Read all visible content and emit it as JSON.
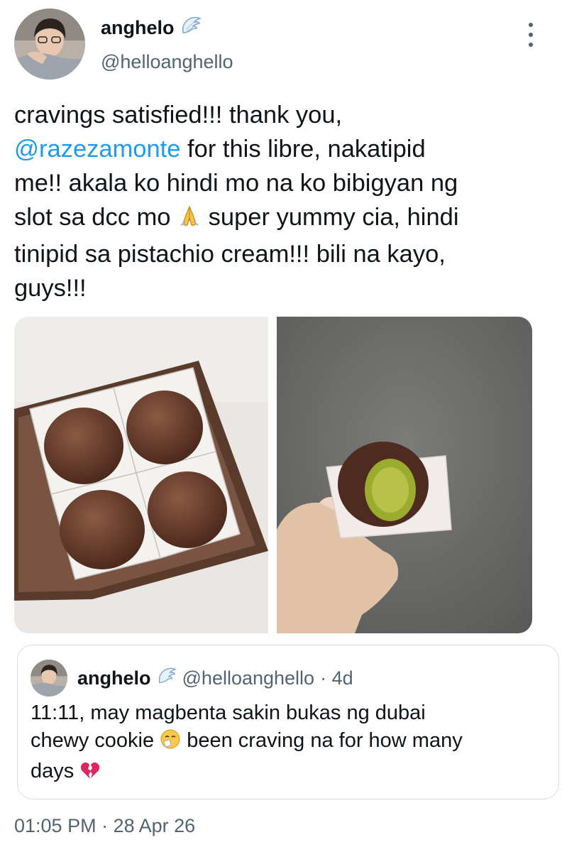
{
  "author": {
    "name": "anghelo",
    "handle": "@helloanghello",
    "badge_icon": "angel-wing-icon"
  },
  "tweet": {
    "line1": "cravings satisfied!!! thank you,",
    "mention": "@razezamonte",
    "line2_rest": " for this libre, nakatipid",
    "line3": "me!! akala ko hindi mo na ko bibigyan ng",
    "line4_a": "slot sa dcc mo ",
    "line4_emoji": "folded-hands-icon",
    "line4_b": " super yummy cia, hindi",
    "line5": "tinipid sa pistachio cream!!! bili na kayo,",
    "line6": "guys!!!"
  },
  "media": [
    {
      "name": "chocolate-truffles-box-photo"
    },
    {
      "name": "pistachio-filled-cookie-photo"
    }
  ],
  "quoted_tweet": {
    "name": "anghelo",
    "handle": "@helloanghello",
    "time": "· 4d",
    "line1": "11:11, may magbenta sakin bukas ng dubai",
    "line2_a": "chewy cookie ",
    "line2_emoji": "sneezing-face-icon",
    "line2_b": " been craving na for how many",
    "line3": "days ",
    "line3_emoji": "broken-heart-icon"
  },
  "timestamp": "01:05 PM · 28 Apr 26",
  "colors": {
    "link": "#1d9bf0",
    "secondary_text": "#536471",
    "primary_text": "#0f1419",
    "border": "#d7dde1"
  }
}
